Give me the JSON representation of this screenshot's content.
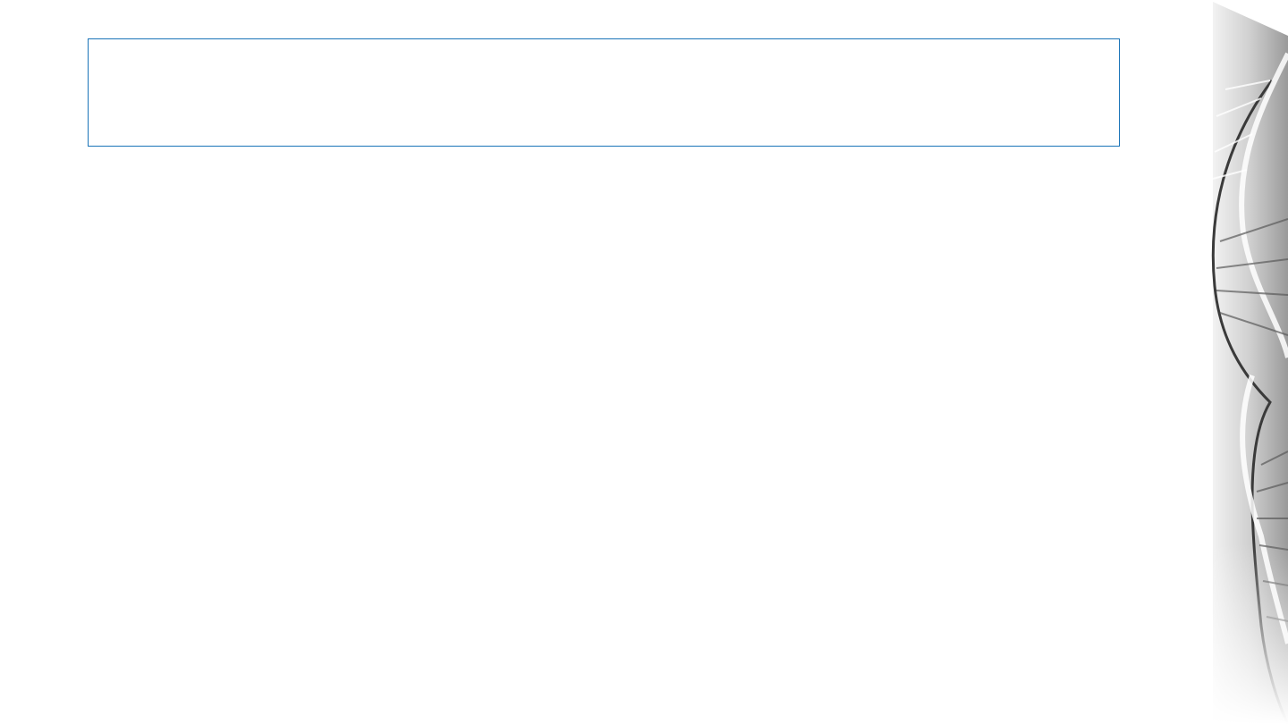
{
  "slide": {
    "title": "",
    "title_box_border_color": "#1a74b8",
    "background_color": "#ffffff"
  },
  "decoration": {
    "icon": "dna-helix-icon",
    "tone": "grayscale"
  }
}
